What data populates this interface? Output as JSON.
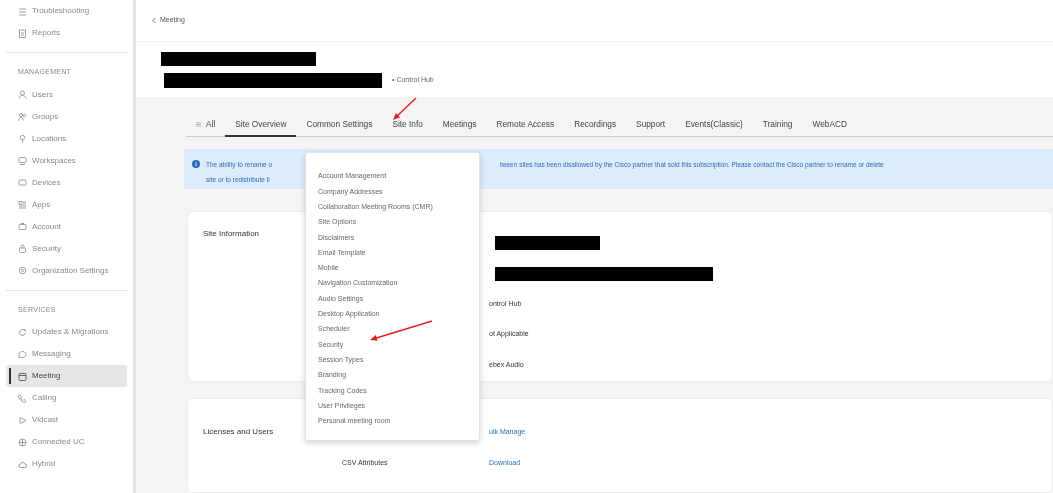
{
  "sidebar": {
    "sections": [
      {
        "items": [
          {
            "label": "Troubleshooting",
            "selected": false
          },
          {
            "label": "Reports",
            "selected": false
          }
        ]
      },
      {
        "heading": "MANAGEMENT",
        "items": [
          {
            "label": "Users",
            "selected": false
          },
          {
            "label": "Groups",
            "selected": false
          },
          {
            "label": "Locations",
            "selected": false
          },
          {
            "label": "Workspaces",
            "selected": false
          },
          {
            "label": "Devices",
            "selected": false
          },
          {
            "label": "Apps",
            "selected": false
          },
          {
            "label": "Account",
            "selected": false
          },
          {
            "label": "Security",
            "selected": false
          },
          {
            "label": "Organization Settings",
            "selected": false
          }
        ]
      },
      {
        "heading": "SERVICES",
        "items": [
          {
            "label": "Updates & Migrations",
            "selected": false
          },
          {
            "label": "Messaging",
            "selected": false
          },
          {
            "label": "Meeting",
            "selected": true
          },
          {
            "label": "Calling",
            "selected": false
          },
          {
            "label": "Vidcast",
            "selected": false
          },
          {
            "label": "Connected UC",
            "selected": false
          },
          {
            "label": "Hybrid",
            "selected": false
          }
        ]
      }
    ]
  },
  "breadcrumb": {
    "back_label": "Meeting"
  },
  "site_header": {
    "subtitle": "• Control Hub"
  },
  "tabs": [
    {
      "label": "All",
      "kind": "menu",
      "selected": false
    },
    {
      "label": "Site Overview",
      "selected": true
    },
    {
      "label": "Common Settings",
      "selected": false
    },
    {
      "label": "Site Info",
      "selected": false
    },
    {
      "label": "Meetings",
      "selected": false
    },
    {
      "label": "Remote Access",
      "selected": false
    },
    {
      "label": "Recordings",
      "selected": false
    },
    {
      "label": "Support",
      "selected": false
    },
    {
      "label": "Events(Classic)",
      "selected": false
    },
    {
      "label": "Training",
      "selected": false
    },
    {
      "label": "WebACD",
      "selected": false
    }
  ],
  "alert": {
    "left_lines": [
      "The ability to rename o",
      "site or to redistribute li"
    ],
    "right_lines": [
      "tween sites has been disallowed by the Cisco partner that sold this subscription. Please contact the Cisco partner to rename or delete"
    ]
  },
  "dropdown": {
    "items": [
      "Account Management",
      "Company Addresses",
      "Collaboration Meeting Rooms (CMR)",
      "Site Options",
      "Disclaimers",
      "Email Template",
      "Mobile",
      "Navigation Customization",
      "Audio Settings",
      "Desktop Application",
      "Scheduler",
      "Security",
      "Session Types",
      "Branding",
      "Tracking Codes",
      "User Privileges",
      "Personal meeting room"
    ]
  },
  "site_information": {
    "title": "Site Information",
    "values": [
      {
        "kind": "redacted"
      },
      {
        "kind": "redacted"
      },
      {
        "kind": "text",
        "text": "ontrol Hub"
      },
      {
        "kind": "text",
        "text": "ot Applicable"
      },
      {
        "kind": "text",
        "text": "ebex Audio"
      }
    ]
  },
  "licenses": {
    "title": "Licenses and Users",
    "rows": [
      {
        "link": "ulk Manage"
      },
      {
        "label": "CSV Attributes",
        "link": "Download"
      }
    ]
  }
}
